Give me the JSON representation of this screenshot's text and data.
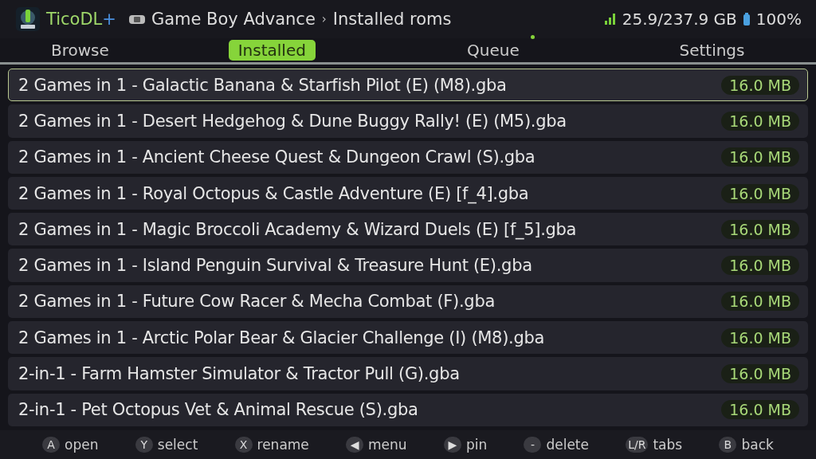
{
  "header": {
    "app_name": "TicoDL",
    "app_suffix": "+",
    "breadcrumb": [
      "Game Boy Advance",
      "Installed roms"
    ],
    "breadcrumb_separator": "›",
    "storage": "25.9/237.9 GB",
    "battery": "100%"
  },
  "tabs": [
    {
      "label": "Browse",
      "selected": false,
      "badge": false
    },
    {
      "label": "Installed",
      "selected": true,
      "badge": false
    },
    {
      "label": "Queue",
      "selected": false,
      "badge": true
    },
    {
      "label": "Settings",
      "selected": false,
      "badge": false
    }
  ],
  "roms": [
    {
      "name": "2 Games in 1 - Galactic Banana & Starfish Pilot (E) (M8).gba",
      "size": "16.0 MB",
      "selected": true
    },
    {
      "name": "2 Games in 1 - Desert Hedgehog & Dune Buggy Rally! (E) (M5).gba",
      "size": "16.0 MB",
      "selected": false
    },
    {
      "name": "2 Games in 1 - Ancient Cheese Quest & Dungeon Crawl (S).gba",
      "size": "16.0 MB",
      "selected": false
    },
    {
      "name": "2 Games in 1 - Royal Octopus & Castle Adventure (E) [f_4].gba",
      "size": "16.0 MB",
      "selected": false
    },
    {
      "name": "2 Games in 1 - Magic Broccoli Academy & Wizard Duels (E) [f_5].gba",
      "size": "16.0 MB",
      "selected": false
    },
    {
      "name": "2 Games in 1 - Island Penguin Survival & Treasure Hunt (E).gba",
      "size": "16.0 MB",
      "selected": false
    },
    {
      "name": "2 Games in 1 - Future Cow Racer & Mecha Combat (F).gba",
      "size": "16.0 MB",
      "selected": false
    },
    {
      "name": "2 Games in 1 - Arctic Polar Bear & Glacier Challenge (I) (M8).gba",
      "size": "16.0 MB",
      "selected": false
    },
    {
      "name": "2-in-1 - Farm Hamster Simulator & Tractor Pull (G).gba",
      "size": "16.0 MB",
      "selected": false
    },
    {
      "name": "2-in-1 - Pet Octopus Vet & Animal Rescue (S).gba",
      "size": "16.0 MB",
      "selected": false
    }
  ],
  "hints": [
    {
      "key": "A",
      "label": "open"
    },
    {
      "key": "Y",
      "label": "select"
    },
    {
      "key": "X",
      "label": "rename"
    },
    {
      "key": "◀",
      "label": "menu"
    },
    {
      "key": "▶",
      "label": "pin"
    },
    {
      "key": "-",
      "label": "delete"
    },
    {
      "key": "L/R",
      "label": "tabs"
    },
    {
      "key": "B",
      "label": "back"
    }
  ]
}
